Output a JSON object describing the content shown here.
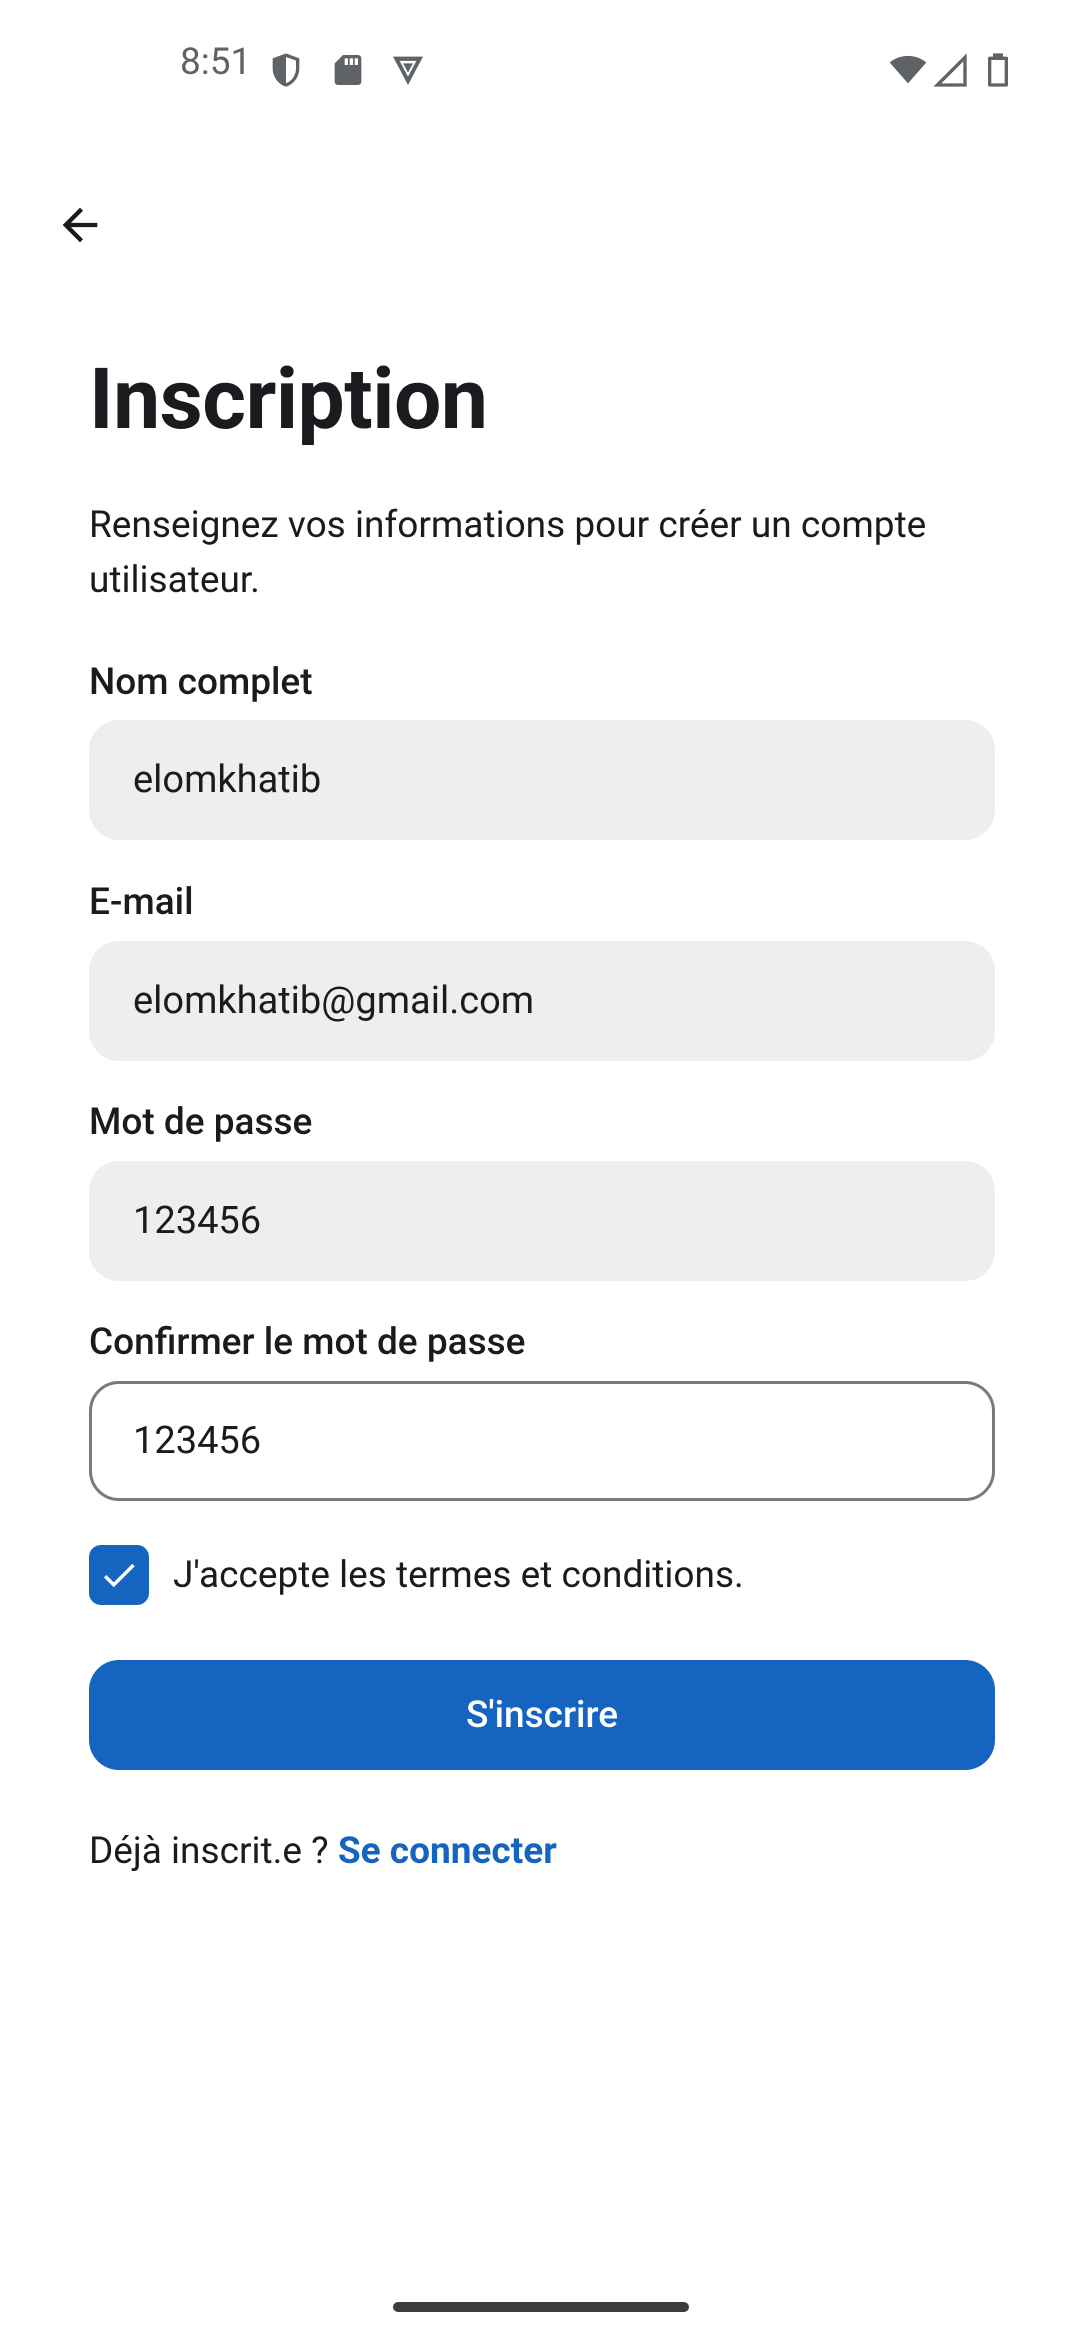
{
  "status_bar": {
    "time": "8:51",
    "icons_left": [
      "shield-icon",
      "sd-card-icon",
      "vpn-icon"
    ],
    "icons_right": [
      "wifi-icon",
      "cell-signal-icon",
      "battery-icon"
    ]
  },
  "header": {
    "back_icon": "arrow-left-icon"
  },
  "page": {
    "title": "Inscription",
    "subtitle": "Renseignez vos informations pour créer un compte utilisateur."
  },
  "form": {
    "full_name": {
      "label": "Nom complet",
      "value": "elomkhatib"
    },
    "email": {
      "label": "E-mail",
      "value": "elomkhatib@gmail.com"
    },
    "password": {
      "label": "Mot de passe",
      "value": "123456"
    },
    "confirm_password": {
      "label": "Confirmer le mot de passe",
      "value": "123456"
    },
    "terms": {
      "label": "J'accepte les termes et conditions.",
      "checked": true
    },
    "submit_label": "S'inscrire"
  },
  "footer": {
    "prompt": "Déjà inscrit.e ?",
    "link": "Se connecter"
  },
  "colors": {
    "primary": "#1565c0",
    "field_background": "#eeeeee",
    "text": "#1b1b1f"
  }
}
